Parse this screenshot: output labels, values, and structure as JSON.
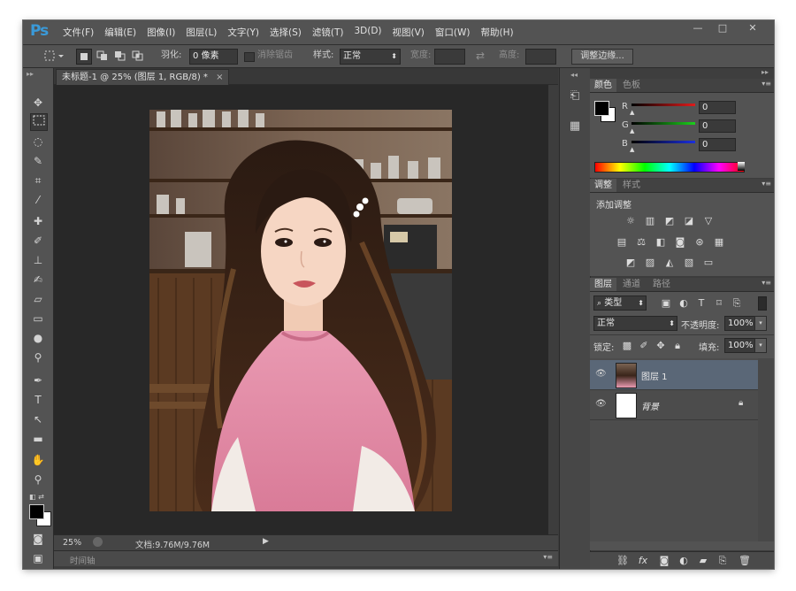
{
  "app": {
    "logo": "Ps"
  },
  "menu": [
    "文件(F)",
    "编辑(E)",
    "图像(I)",
    "图层(L)",
    "文字(Y)",
    "选择(S)",
    "滤镜(T)",
    "3D(D)",
    "视图(V)",
    "窗口(W)",
    "帮助(H)"
  ],
  "window_controls": {
    "minimize": "—",
    "maximize": "□",
    "close": "✕"
  },
  "options": {
    "feather_label": "羽化:",
    "feather_value": "0 像素",
    "antialias_label": "消除锯齿",
    "style_label": "样式:",
    "style_value": "正常",
    "width_label": "宽度:",
    "height_label": "高度:",
    "refine_edge": "调整边缘..."
  },
  "document": {
    "tab_title": "未标题-1 @ 25% (图层 1, RGB/8) *",
    "tab_close": "×",
    "zoom": "25%",
    "doc_info": "文档:9.76M/9.76M",
    "timeline": "时间轴"
  },
  "panels": {
    "color": {
      "tabs": [
        "颜色",
        "色板"
      ],
      "channels": [
        {
          "label": "R",
          "value": "0",
          "color": "#d42b2b"
        },
        {
          "label": "G",
          "value": "0",
          "color": "#2bb32b"
        },
        {
          "label": "B",
          "value": "0",
          "color": "#2b3ed4"
        }
      ]
    },
    "adjustments": {
      "tabs": [
        "调整",
        "样式"
      ],
      "heading": "添加调整"
    },
    "layers": {
      "tabs": [
        "图层",
        "通道",
        "路径"
      ],
      "filter_kind": "类型",
      "blend_mode": "正常",
      "opacity_label": "不透明度:",
      "opacity_value": "100%",
      "lock_label": "锁定:",
      "fill_label": "填充:",
      "fill_value": "100%",
      "items": [
        {
          "name": "图层 1",
          "selected": true
        },
        {
          "name": "背景",
          "locked": true
        }
      ]
    }
  },
  "colors": {
    "chrome": "#535353",
    "canvas_bg": "#282828",
    "selected_layer": "#5a6777",
    "ps_blue": "#3a9ad9"
  }
}
